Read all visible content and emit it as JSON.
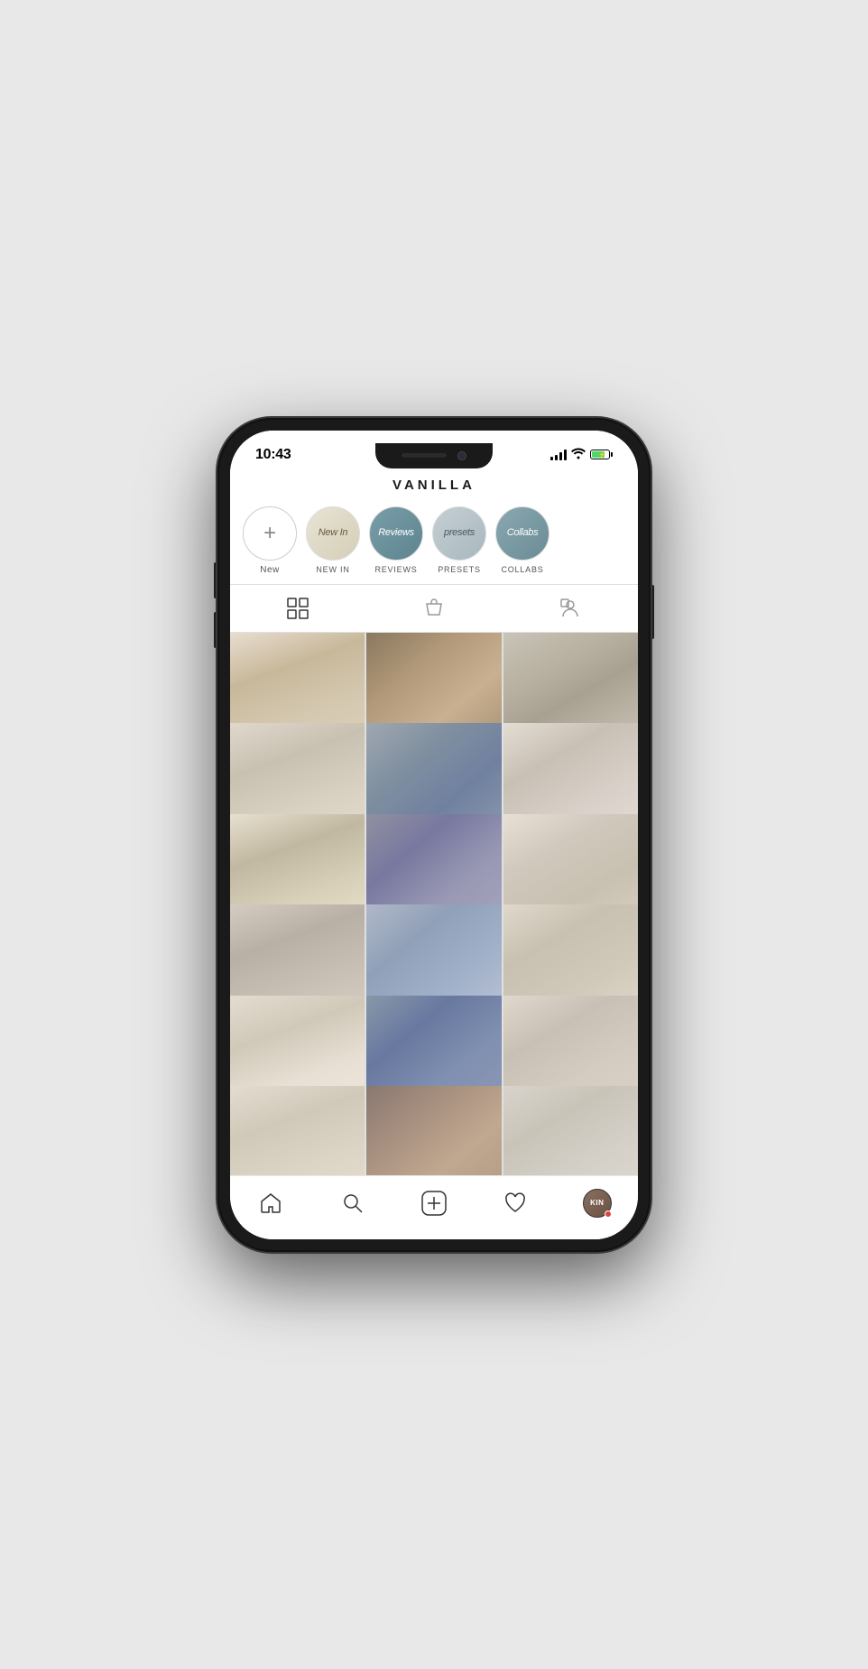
{
  "phone": {
    "status_bar": {
      "time": "10:43"
    },
    "header": {
      "title": "VANILLA"
    },
    "stories": [
      {
        "id": "new",
        "type": "new",
        "label": "New",
        "label_style": "normal"
      },
      {
        "id": "new-in",
        "type": "new-in",
        "text": "New In",
        "label": "NEW IN",
        "label_style": "upper"
      },
      {
        "id": "reviews",
        "type": "reviews",
        "text": "Reviews",
        "label": "REVIEWS",
        "label_style": "upper"
      },
      {
        "id": "presets",
        "type": "presets",
        "text": "presets",
        "label": "PRESETS",
        "label_style": "upper"
      },
      {
        "id": "collabs",
        "type": "collabs",
        "text": "Collabs",
        "label": "COLLABS",
        "label_style": "upper"
      }
    ],
    "tabs": [
      {
        "id": "grid",
        "icon": "grid-icon",
        "active": true
      },
      {
        "id": "shop",
        "icon": "shop-icon",
        "active": false
      },
      {
        "id": "tag",
        "icon": "tag-icon",
        "active": false
      }
    ],
    "grid": {
      "photos": [
        {
          "id": 1,
          "class": "photo-1"
        },
        {
          "id": 2,
          "class": "photo-2"
        },
        {
          "id": 3,
          "class": "photo-3"
        },
        {
          "id": 4,
          "class": "photo-4"
        },
        {
          "id": 5,
          "class": "photo-5"
        },
        {
          "id": 6,
          "class": "photo-6"
        },
        {
          "id": 7,
          "class": "photo-7"
        },
        {
          "id": 8,
          "class": "photo-8"
        },
        {
          "id": 9,
          "class": "photo-9"
        },
        {
          "id": 10,
          "class": "photo-10"
        },
        {
          "id": 11,
          "class": "photo-11"
        },
        {
          "id": 12,
          "class": "photo-12"
        },
        {
          "id": 13,
          "class": "photo-13"
        },
        {
          "id": 14,
          "class": "photo-14"
        },
        {
          "id": 15,
          "class": "photo-15"
        },
        {
          "id": 16,
          "class": "photo-16"
        },
        {
          "id": 17,
          "class": "photo-17"
        },
        {
          "id": 18,
          "class": "photo-18"
        }
      ]
    },
    "bottom_nav": [
      {
        "id": "home",
        "icon": "home-icon"
      },
      {
        "id": "search",
        "icon": "search-icon"
      },
      {
        "id": "add",
        "icon": "add-icon"
      },
      {
        "id": "heart",
        "icon": "heart-icon"
      },
      {
        "id": "profile",
        "icon": "profile-icon",
        "avatar_text": "KIN",
        "has_dot": true
      }
    ]
  }
}
